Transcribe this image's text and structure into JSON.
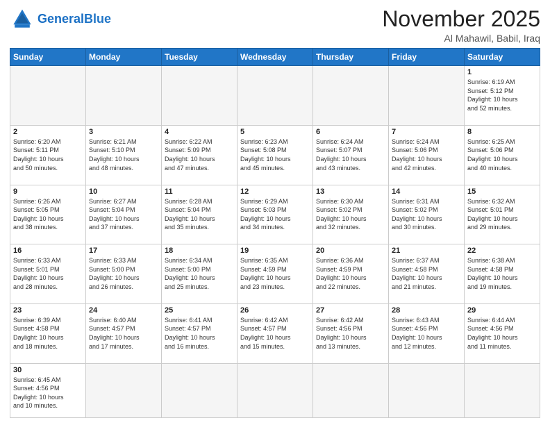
{
  "header": {
    "logo_general": "General",
    "logo_blue": "Blue",
    "month": "November 2025",
    "location": "Al Mahawil, Babil, Iraq"
  },
  "weekdays": [
    "Sunday",
    "Monday",
    "Tuesday",
    "Wednesday",
    "Thursday",
    "Friday",
    "Saturday"
  ],
  "weeks": [
    [
      {
        "day": "",
        "info": ""
      },
      {
        "day": "",
        "info": ""
      },
      {
        "day": "",
        "info": ""
      },
      {
        "day": "",
        "info": ""
      },
      {
        "day": "",
        "info": ""
      },
      {
        "day": "",
        "info": ""
      },
      {
        "day": "1",
        "info": "Sunrise: 6:19 AM\nSunset: 5:12 PM\nDaylight: 10 hours\nand 52 minutes."
      }
    ],
    [
      {
        "day": "2",
        "info": "Sunrise: 6:20 AM\nSunset: 5:11 PM\nDaylight: 10 hours\nand 50 minutes."
      },
      {
        "day": "3",
        "info": "Sunrise: 6:21 AM\nSunset: 5:10 PM\nDaylight: 10 hours\nand 48 minutes."
      },
      {
        "day": "4",
        "info": "Sunrise: 6:22 AM\nSunset: 5:09 PM\nDaylight: 10 hours\nand 47 minutes."
      },
      {
        "day": "5",
        "info": "Sunrise: 6:23 AM\nSunset: 5:08 PM\nDaylight: 10 hours\nand 45 minutes."
      },
      {
        "day": "6",
        "info": "Sunrise: 6:24 AM\nSunset: 5:07 PM\nDaylight: 10 hours\nand 43 minutes."
      },
      {
        "day": "7",
        "info": "Sunrise: 6:24 AM\nSunset: 5:06 PM\nDaylight: 10 hours\nand 42 minutes."
      },
      {
        "day": "8",
        "info": "Sunrise: 6:25 AM\nSunset: 5:06 PM\nDaylight: 10 hours\nand 40 minutes."
      }
    ],
    [
      {
        "day": "9",
        "info": "Sunrise: 6:26 AM\nSunset: 5:05 PM\nDaylight: 10 hours\nand 38 minutes."
      },
      {
        "day": "10",
        "info": "Sunrise: 6:27 AM\nSunset: 5:04 PM\nDaylight: 10 hours\nand 37 minutes."
      },
      {
        "day": "11",
        "info": "Sunrise: 6:28 AM\nSunset: 5:04 PM\nDaylight: 10 hours\nand 35 minutes."
      },
      {
        "day": "12",
        "info": "Sunrise: 6:29 AM\nSunset: 5:03 PM\nDaylight: 10 hours\nand 34 minutes."
      },
      {
        "day": "13",
        "info": "Sunrise: 6:30 AM\nSunset: 5:02 PM\nDaylight: 10 hours\nand 32 minutes."
      },
      {
        "day": "14",
        "info": "Sunrise: 6:31 AM\nSunset: 5:02 PM\nDaylight: 10 hours\nand 30 minutes."
      },
      {
        "day": "15",
        "info": "Sunrise: 6:32 AM\nSunset: 5:01 PM\nDaylight: 10 hours\nand 29 minutes."
      }
    ],
    [
      {
        "day": "16",
        "info": "Sunrise: 6:33 AM\nSunset: 5:01 PM\nDaylight: 10 hours\nand 28 minutes."
      },
      {
        "day": "17",
        "info": "Sunrise: 6:33 AM\nSunset: 5:00 PM\nDaylight: 10 hours\nand 26 minutes."
      },
      {
        "day": "18",
        "info": "Sunrise: 6:34 AM\nSunset: 5:00 PM\nDaylight: 10 hours\nand 25 minutes."
      },
      {
        "day": "19",
        "info": "Sunrise: 6:35 AM\nSunset: 4:59 PM\nDaylight: 10 hours\nand 23 minutes."
      },
      {
        "day": "20",
        "info": "Sunrise: 6:36 AM\nSunset: 4:59 PM\nDaylight: 10 hours\nand 22 minutes."
      },
      {
        "day": "21",
        "info": "Sunrise: 6:37 AM\nSunset: 4:58 PM\nDaylight: 10 hours\nand 21 minutes."
      },
      {
        "day": "22",
        "info": "Sunrise: 6:38 AM\nSunset: 4:58 PM\nDaylight: 10 hours\nand 19 minutes."
      }
    ],
    [
      {
        "day": "23",
        "info": "Sunrise: 6:39 AM\nSunset: 4:58 PM\nDaylight: 10 hours\nand 18 minutes."
      },
      {
        "day": "24",
        "info": "Sunrise: 6:40 AM\nSunset: 4:57 PM\nDaylight: 10 hours\nand 17 minutes."
      },
      {
        "day": "25",
        "info": "Sunrise: 6:41 AM\nSunset: 4:57 PM\nDaylight: 10 hours\nand 16 minutes."
      },
      {
        "day": "26",
        "info": "Sunrise: 6:42 AM\nSunset: 4:57 PM\nDaylight: 10 hours\nand 15 minutes."
      },
      {
        "day": "27",
        "info": "Sunrise: 6:42 AM\nSunset: 4:56 PM\nDaylight: 10 hours\nand 13 minutes."
      },
      {
        "day": "28",
        "info": "Sunrise: 6:43 AM\nSunset: 4:56 PM\nDaylight: 10 hours\nand 12 minutes."
      },
      {
        "day": "29",
        "info": "Sunrise: 6:44 AM\nSunset: 4:56 PM\nDaylight: 10 hours\nand 11 minutes."
      }
    ],
    [
      {
        "day": "30",
        "info": "Sunrise: 6:45 AM\nSunset: 4:56 PM\nDaylight: 10 hours\nand 10 minutes."
      },
      {
        "day": "",
        "info": ""
      },
      {
        "day": "",
        "info": ""
      },
      {
        "day": "",
        "info": ""
      },
      {
        "day": "",
        "info": ""
      },
      {
        "day": "",
        "info": ""
      },
      {
        "day": "",
        "info": ""
      }
    ]
  ]
}
